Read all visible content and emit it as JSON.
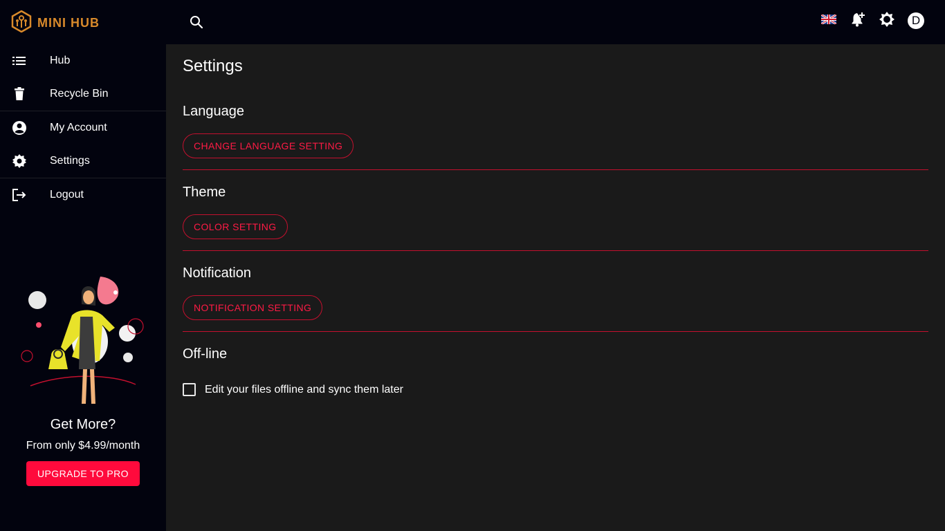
{
  "app": {
    "name": "MINI HUB"
  },
  "header": {
    "avatar_letter": "D"
  },
  "sidebar": {
    "items": [
      {
        "label": "Hub"
      },
      {
        "label": "Recycle Bin"
      },
      {
        "label": "My Account"
      },
      {
        "label": "Settings"
      },
      {
        "label": "Logout"
      }
    ],
    "promo": {
      "title": "Get More?",
      "subtitle": "From only $4.99/month",
      "button": "UPGRADE TO PRO"
    }
  },
  "main": {
    "title": "Settings",
    "sections": [
      {
        "title": "Language",
        "button": "CHANGE LANGUAGE SETTING"
      },
      {
        "title": "Theme",
        "button": "COLOR SETTING"
      },
      {
        "title": "Notification",
        "button": "NOTIFICATION SETTING"
      },
      {
        "title": "Off-line",
        "checkbox_label": "Edit your files offline and sync them later",
        "checked": false
      }
    ]
  },
  "colors": {
    "accent": "#ff0a3c",
    "logo": "#d98a2b",
    "background": "#1a1a1a",
    "sidebar": "#02030e"
  }
}
